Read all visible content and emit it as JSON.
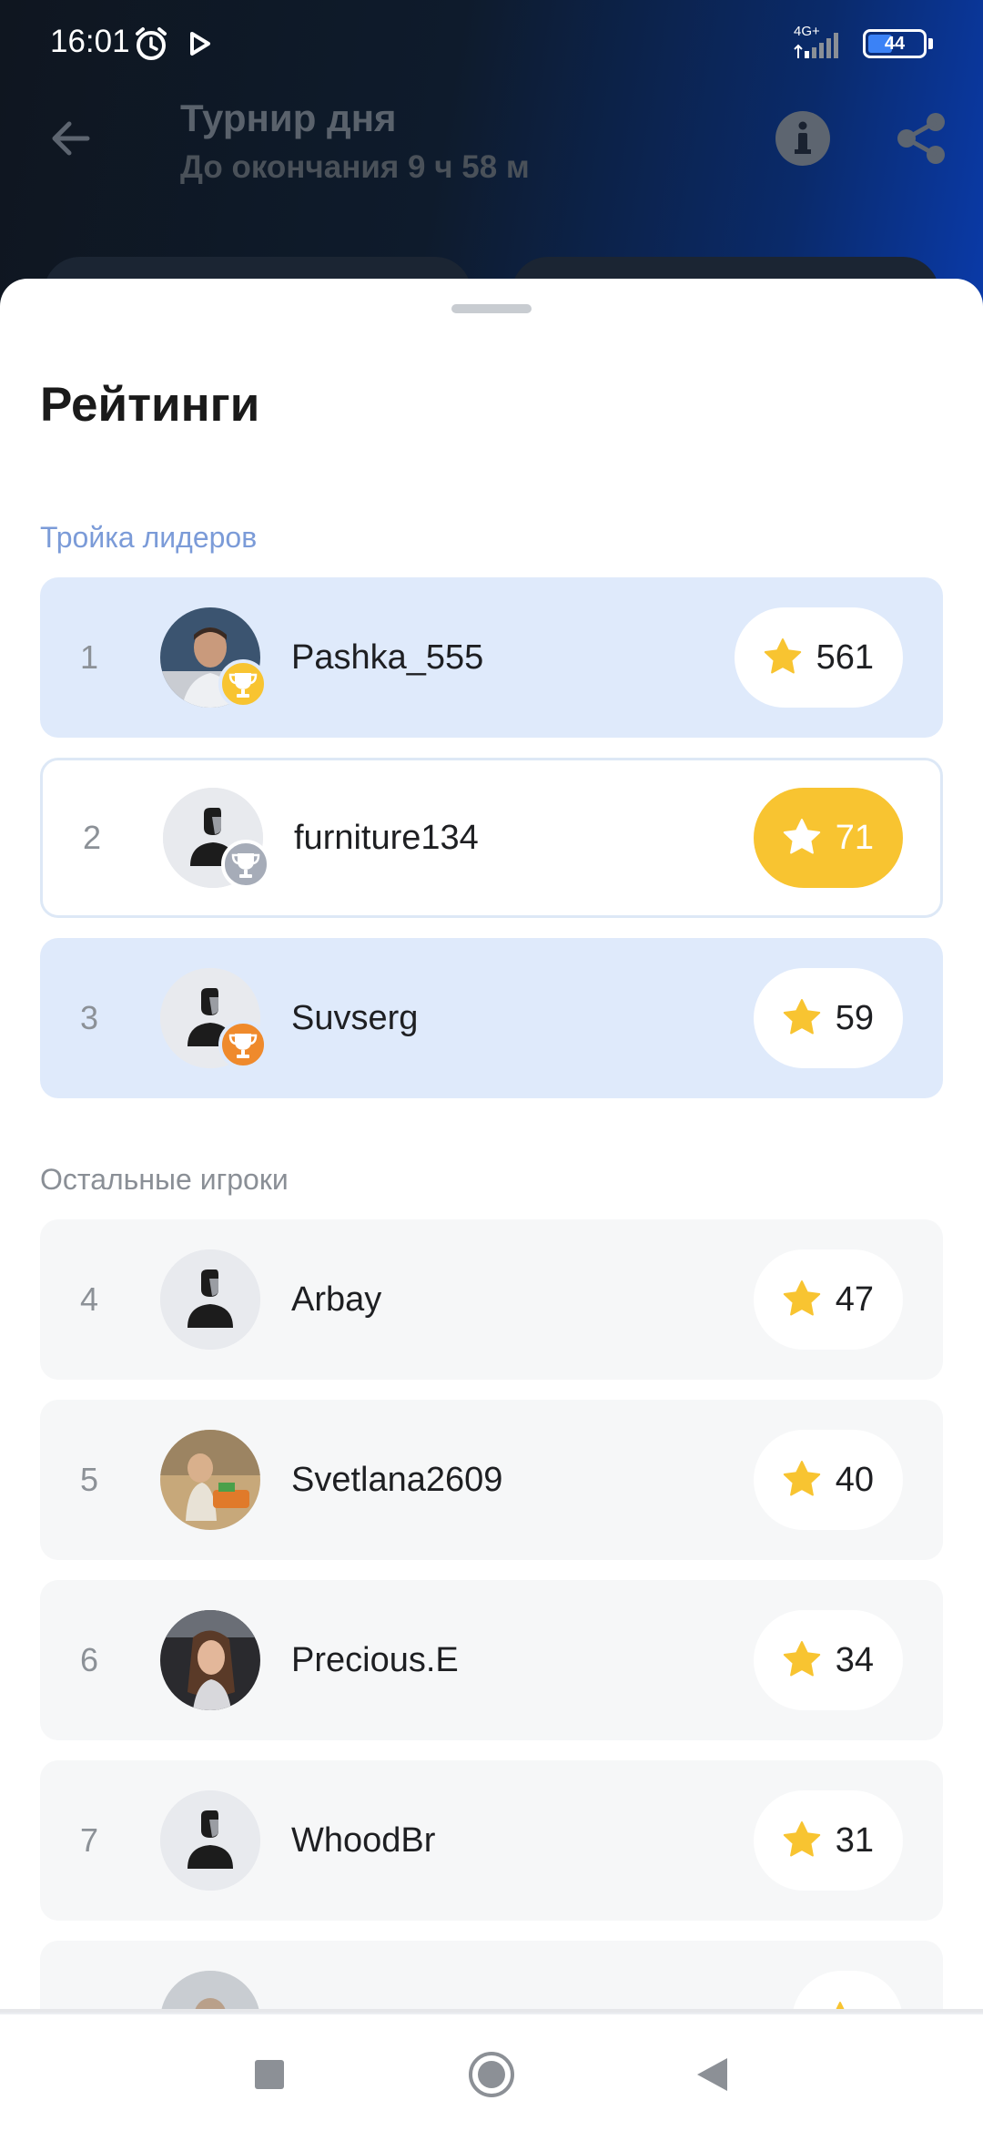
{
  "status_bar": {
    "time": "16:01",
    "network": "4G+",
    "battery": "44",
    "battery_level": 0.44
  },
  "app_bar": {
    "title": "Турнир дня",
    "subtitle": "До окончания 9 ч 58 м",
    "icons": [
      "back-arrow-icon",
      "info-icon",
      "share-icon"
    ]
  },
  "sheet": {
    "title": "Рейтинги",
    "leaders_label": "Тройка лидеров",
    "others_label": "Остальные игроки",
    "leaders": [
      {
        "rank": "1",
        "name": "Pashka_555",
        "score": "561",
        "trophy": "gold",
        "avatar": "photo"
      },
      {
        "rank": "2",
        "name": "furniture134",
        "score": "71",
        "trophy": "silver",
        "avatar": "placeholder",
        "highlighted": true
      },
      {
        "rank": "3",
        "name": "Suvserg",
        "score": "59",
        "trophy": "bronze",
        "avatar": "placeholder"
      }
    ],
    "others": [
      {
        "rank": "4",
        "name": "Arbay",
        "score": "47",
        "avatar": "placeholder"
      },
      {
        "rank": "5",
        "name": "Svetlana2609",
        "score": "40",
        "avatar": "photo"
      },
      {
        "rank": "6",
        "name": "Precious.E",
        "score": "34",
        "avatar": "photo"
      },
      {
        "rank": "7",
        "name": "WhoodBr",
        "score": "31",
        "avatar": "placeholder"
      }
    ]
  },
  "colors": {
    "leader_row": "#dfeafb",
    "other_row": "#f6f7f8",
    "accent_gold": "#f8c431",
    "section_label_blue": "#7b9bd8"
  },
  "nav_bar": {
    "icons": [
      "recents-square-icon",
      "home-circle-icon",
      "back-triangle-icon"
    ]
  }
}
